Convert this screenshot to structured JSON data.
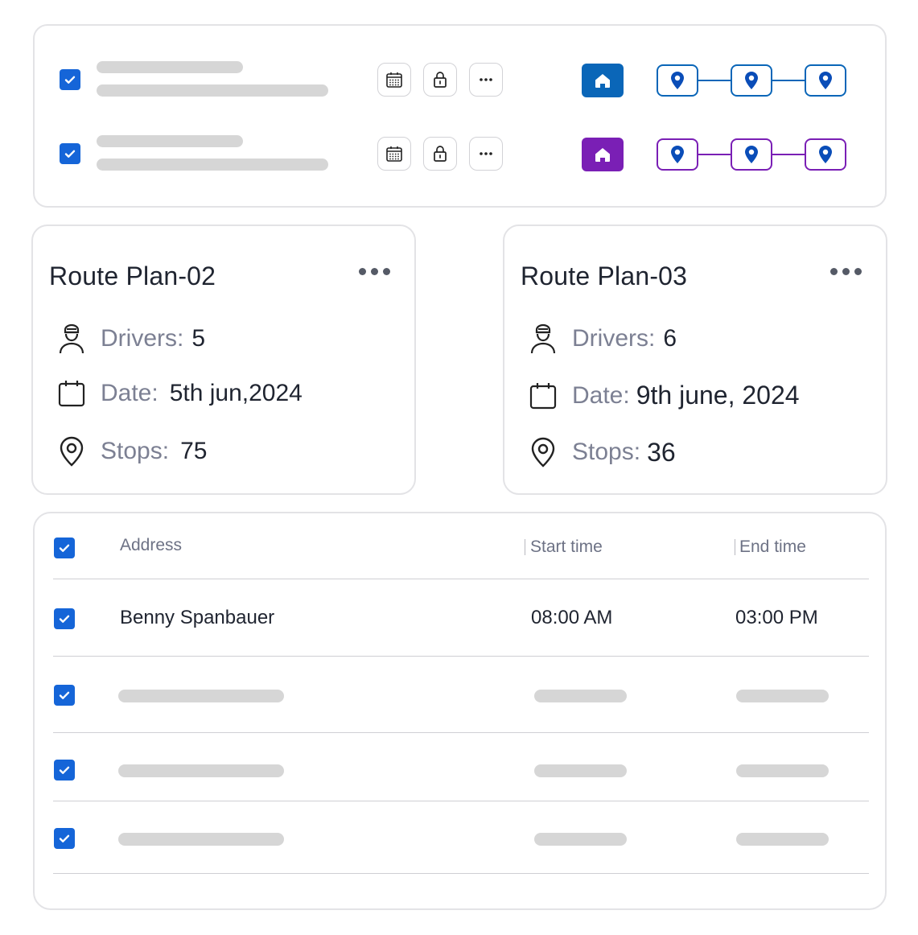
{
  "colors": {
    "accent_blue": "#1565d8",
    "route_blue": "#0a66b8",
    "route_purple": "#7a1fb5",
    "skeleton": "#d6d6d6"
  },
  "route_rows": [
    {
      "checked": true,
      "icons": [
        "calendar-icon",
        "lock-icon",
        "more-icon"
      ],
      "home_color": "#0a66b8",
      "stop_count": 3
    },
    {
      "checked": true,
      "icons": [
        "calendar-icon",
        "lock-icon",
        "more-icon"
      ],
      "home_color": "#7a1fb5",
      "stop_count": 3
    }
  ],
  "plans": [
    {
      "title": "Route Plan-02",
      "drivers_label": "Drivers:",
      "drivers_value": "5",
      "date_label": "Date:",
      "date_value": "5th jun,2024",
      "stops_label": "Stops:",
      "stops_value": "75"
    },
    {
      "title": "Route Plan-03",
      "drivers_label": "Drivers:",
      "drivers_value": "6",
      "date_label": "Date:",
      "date_value": "9th june, 2024",
      "stops_label": "Stops:",
      "stops_value": "36"
    }
  ],
  "table": {
    "headers": {
      "address": "Address",
      "start": "Start time",
      "end": "End time"
    },
    "rows": [
      {
        "address": "Benny Spanbauer",
        "start": "08:00 AM",
        "end": "03:00 PM"
      }
    ]
  }
}
